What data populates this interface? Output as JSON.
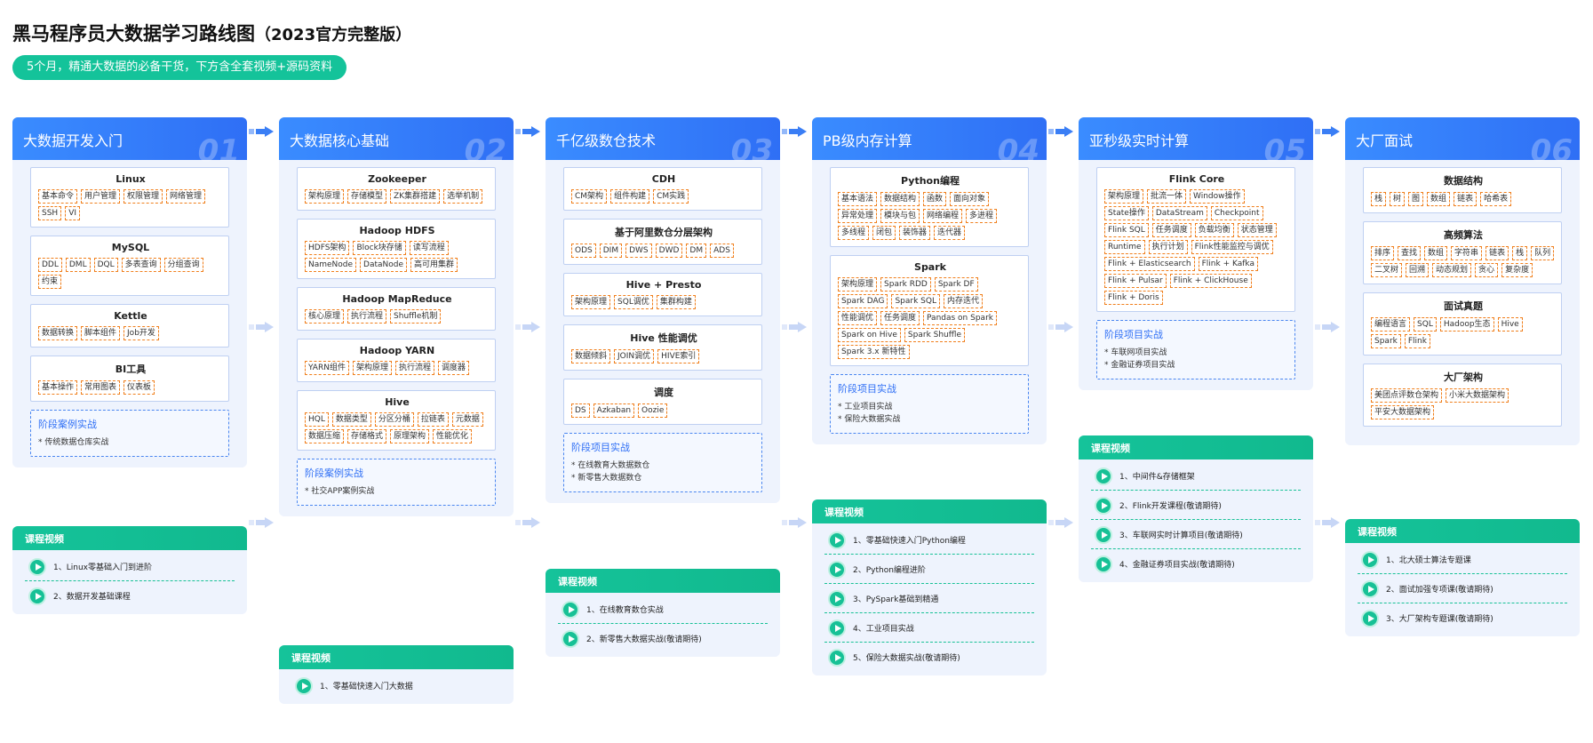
{
  "title": {
    "main": "黑马程序员大数据学习路线图",
    "sub": "（2023官方完整版）"
  },
  "subtitle": "5个月，精通大数据的必备干货，下方含全套视频+源码资料",
  "video_title": "课程视频",
  "stages": [
    {
      "name": "大数据开发入门",
      "num": "01",
      "modules": [
        {
          "title": "Linux",
          "tags": [
            "基本命令",
            "用户管理",
            "权限管理",
            "网络管理",
            "SSH",
            "VI"
          ]
        },
        {
          "title": "MySQL",
          "tags": [
            "DDL",
            "DML",
            "DQL",
            "多表查询",
            "分组查询",
            "约束"
          ]
        },
        {
          "title": "Kettle",
          "tags": [
            "数据转换",
            "脚本组件",
            "Job开发"
          ]
        },
        {
          "title": "BI工具",
          "tags": [
            "基本操作",
            "常用图表",
            "仪表板"
          ]
        }
      ],
      "project": {
        "title": "阶段案例实战",
        "items": [
          "* 传统数据仓库实战"
        ]
      },
      "videos": [
        "1、Linux零基础入门到进阶",
        "2、数据开发基础课程"
      ]
    },
    {
      "name": "大数据核心基础",
      "num": "02",
      "modules": [
        {
          "title": "Zookeeper",
          "tags": [
            "架构原理",
            "存储模型",
            "ZK集群搭建",
            "选举机制"
          ]
        },
        {
          "title": "Hadoop HDFS",
          "tags": [
            "HDFS架构",
            "Block块存储",
            "读写流程",
            "NameNode",
            "DataNode",
            "高可用集群"
          ]
        },
        {
          "title": "Hadoop MapReduce",
          "tags": [
            "核心原理",
            "执行流程",
            "Shuffle机制"
          ]
        },
        {
          "title": "Hadoop YARN",
          "tags": [
            "YARN组件",
            "架构原理",
            "执行流程",
            "调度器"
          ]
        },
        {
          "title": "Hive",
          "tags": [
            "HQL",
            "数据类型",
            "分区分桶",
            "拉链表",
            "元数据",
            "数据压缩",
            "存储格式",
            "原理架构",
            "性能优化"
          ]
        }
      ],
      "project": {
        "title": "阶段案例实战",
        "items": [
          "* 社交APP案例实战"
        ]
      },
      "videos": [
        "1、零基础快速入门大数据"
      ]
    },
    {
      "name": "千亿级数仓技术",
      "num": "03",
      "modules": [
        {
          "title": "CDH",
          "tags": [
            "CM架构",
            "组件构建",
            "CM实践"
          ]
        },
        {
          "title": "基于阿里数仓分层架构",
          "tags": [
            "ODS",
            "DIM",
            "DWS",
            "DWD",
            "DM",
            "ADS"
          ]
        },
        {
          "title": "Hive + Presto",
          "tags": [
            "架构原理",
            "SQL调优",
            "集群构建"
          ]
        },
        {
          "title": "Hive 性能调优",
          "tags": [
            "数据倾斜",
            "JOIN调优",
            "HIVE索引"
          ]
        },
        {
          "title": "调度",
          "tags": [
            "DS",
            "Azkaban",
            "Oozie"
          ]
        }
      ],
      "project": {
        "title": "阶段项目实战",
        "items": [
          "* 在线教育大数据数仓",
          "* 新零售大数据数仓"
        ]
      },
      "videos": [
        "1、在线教育数仓实战",
        "2、新零售大数据实战(敬请期待)"
      ]
    },
    {
      "name": "PB级内存计算",
      "num": "04",
      "modules": [
        {
          "title": "Python编程",
          "tags": [
            "基本语法",
            "数据结构",
            "函数",
            "面向对象",
            "异常处理",
            "模块与包",
            "网络编程",
            "多进程",
            "多线程",
            "闭包",
            "装饰器",
            "迭代器"
          ]
        },
        {
          "title": "Spark",
          "tags": [
            "架构原理",
            "Spark RDD",
            "Spark DF",
            "Spark DAG",
            "Spark SQL",
            "内存迭代",
            "性能调优",
            "任务调度",
            "Pandas on Spark",
            "Spark on Hive",
            "Spark Shuffle",
            "Spark 3.x 新特性"
          ]
        }
      ],
      "project": {
        "title": "阶段项目实战",
        "items": [
          "* 工业项目实战",
          "* 保险大数据实战"
        ]
      },
      "videos": [
        "1、零基础快速入门Python编程",
        "2、Python编程进阶",
        "3、PySpark基础到精通",
        "4、工业项目实战",
        "5、保险大数据实战(敬请期待)"
      ]
    },
    {
      "name": "亚秒级实时计算",
      "num": "05",
      "modules": [
        {
          "title": "Flink Core",
          "tags": [
            "架构原理",
            "批流一体",
            "Window操作",
            "State操作",
            "DataStream",
            "Checkpoint",
            "Flink SQL",
            "任务调度",
            "负载均衡",
            "状态管理",
            "Runtime",
            "执行计划",
            "Flink性能监控与调优",
            "Flink + Elasticsearch",
            "Flink + Kafka",
            "Flink + Pulsar",
            "Flink + ClickHouse",
            "Flink + Doris"
          ]
        }
      ],
      "project": {
        "title": "阶段项目实战",
        "items": [
          "* 车联网项目实战",
          "* 金融证券项目实战"
        ]
      },
      "videos": [
        "1、中间件&存储框架",
        "2、Flink开发课程(敬请期待)",
        "3、车联网实时计算项目(敬请期待)",
        "4、金融证券项目实战(敬请期待)"
      ]
    },
    {
      "name": "大厂面试",
      "num": "06",
      "modules": [
        {
          "title": "数据结构",
          "tags": [
            "栈",
            "树",
            "图",
            "数组",
            "链表",
            "哈希表"
          ]
        },
        {
          "title": "高频算法",
          "tags": [
            "排序",
            "查找",
            "数组",
            "字符串",
            "链表",
            "栈",
            "队列",
            "二叉树",
            "回溯",
            "动态规划",
            "贪心",
            "复杂度"
          ]
        },
        {
          "title": "面试真题",
          "tags": [
            "编程语言",
            "SQL",
            "Hadoop生态",
            "Hive",
            "Spark",
            "Flink"
          ]
        },
        {
          "title": "大厂架构",
          "tags": [
            "美团点评数仓架构",
            "小米大数据架构",
            "平安大数据架构"
          ]
        }
      ],
      "project": null,
      "videos": [
        "1、北大硕士算法专题课",
        "2、面试加强专项课(敬请期待)",
        "3、大厂架构专题课(敬请期待)"
      ]
    }
  ]
}
